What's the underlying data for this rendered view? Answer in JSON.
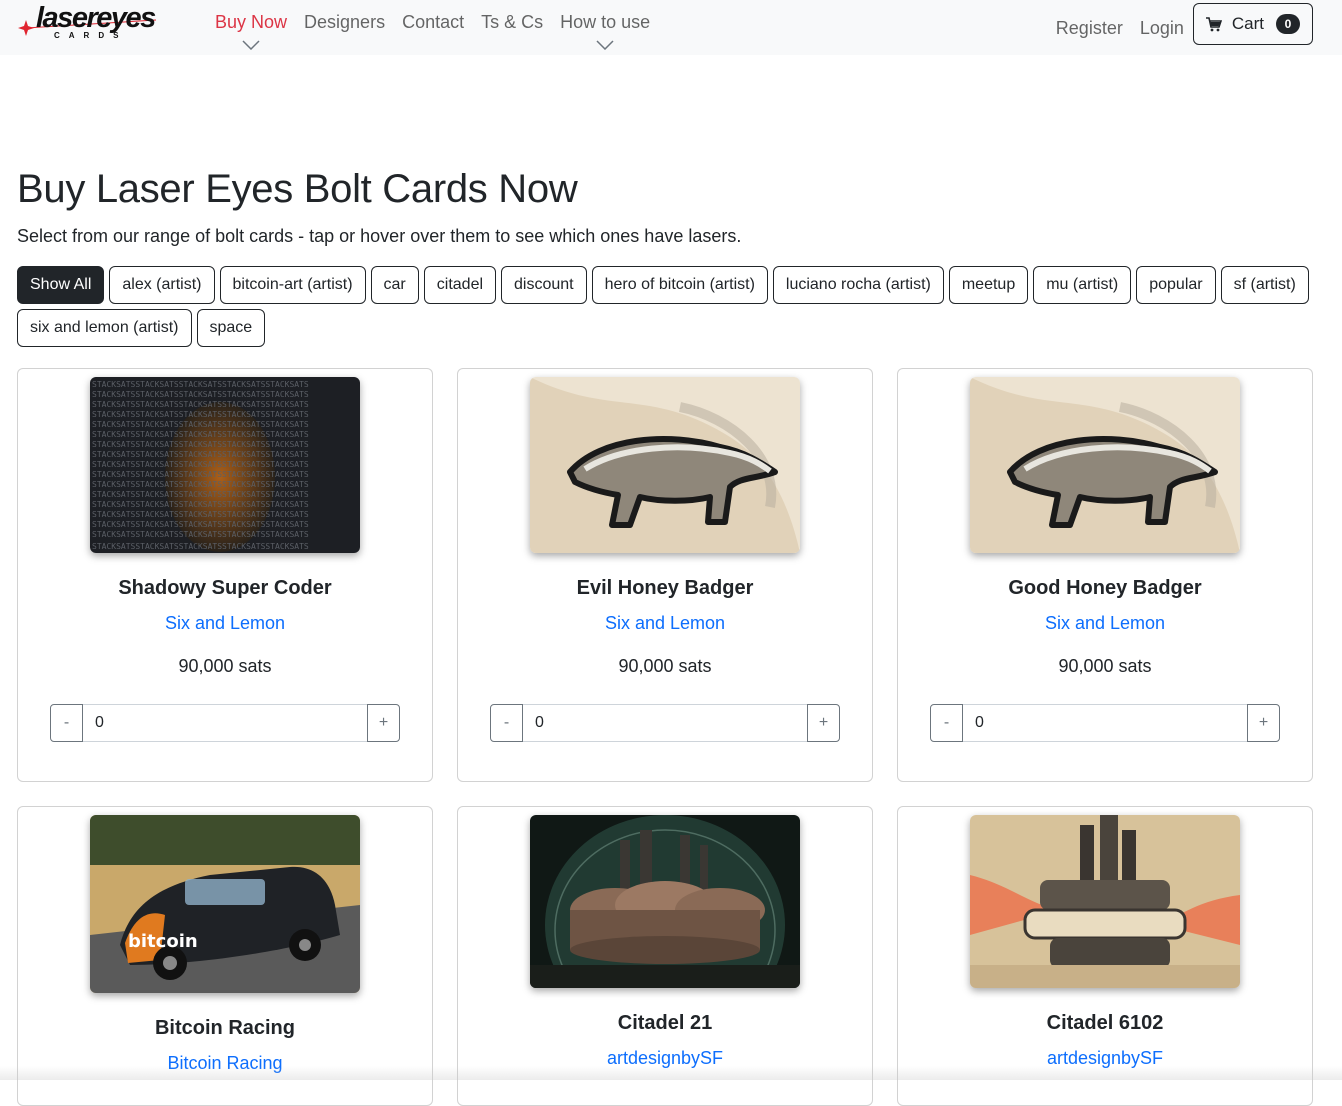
{
  "brand": {
    "logo_text": "lasereyes",
    "logo_sub": "CARDS"
  },
  "nav": {
    "items": [
      {
        "label": "Buy Now",
        "active": true,
        "has_dropdown": true
      },
      {
        "label": "Designers",
        "active": false,
        "has_dropdown": false
      },
      {
        "label": "Contact",
        "active": false,
        "has_dropdown": false
      },
      {
        "label": "Ts & Cs",
        "active": false,
        "has_dropdown": false
      },
      {
        "label": "How to use",
        "active": false,
        "has_dropdown": true
      }
    ],
    "register": "Register",
    "login": "Login",
    "cart_label": "Cart",
    "cart_count": "0",
    "active_color": "#dc3545"
  },
  "page": {
    "title": "Buy Laser Eyes Bolt Cards Now",
    "subtitle": "Select from our range of bolt cards - tap or hover over them to see which ones have lasers."
  },
  "filters": [
    {
      "label": "Show All",
      "active": true
    },
    {
      "label": "alex (artist)",
      "active": false
    },
    {
      "label": "bitcoin-art (artist)",
      "active": false
    },
    {
      "label": "car",
      "active": false
    },
    {
      "label": "citadel",
      "active": false
    },
    {
      "label": "discount",
      "active": false
    },
    {
      "label": "hero of bitcoin (artist)",
      "active": false
    },
    {
      "label": "luciano rocha (artist)",
      "active": false
    },
    {
      "label": "meetup",
      "active": false
    },
    {
      "label": "mu (artist)",
      "active": false
    },
    {
      "label": "popular",
      "active": false
    },
    {
      "label": "sf (artist)",
      "active": false
    },
    {
      "label": "six and lemon (artist)",
      "active": false
    },
    {
      "label": "space",
      "active": false
    }
  ],
  "products": [
    {
      "name": "Shadowy Super Coder",
      "artist": "Six and Lemon",
      "price": "90,000 sats",
      "quantity": "0",
      "image": "stack-sats-text-art"
    },
    {
      "name": "Evil Honey Badger",
      "artist": "Six and Lemon",
      "price": "90,000 sats",
      "quantity": "0",
      "image": "honey-badger-art"
    },
    {
      "name": "Good Honey Badger",
      "artist": "Six and Lemon",
      "price": "90,000 sats",
      "quantity": "0",
      "image": "honey-badger-art"
    },
    {
      "name": "Bitcoin Racing",
      "artist": "Bitcoin Racing",
      "image": "race-car-photo"
    },
    {
      "name": "Citadel 21",
      "artist": "artdesignbySF",
      "image": "dome-citadel-art"
    },
    {
      "name": "Citadel 6102",
      "artist": "artdesignbySF",
      "image": "brutalist-citadel-art"
    }
  ],
  "qty_controls": {
    "minus": "-",
    "plus": "+"
  },
  "colors": {
    "link": "#0d6efd",
    "dark": "#212529",
    "navbar_bg": "#f8f9fa"
  }
}
